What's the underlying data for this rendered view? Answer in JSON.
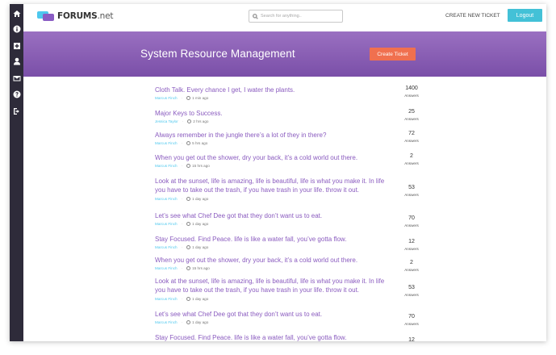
{
  "app": {
    "logo_brand": "FORUMS",
    "logo_suffix": ".net"
  },
  "sidebar": {
    "items": [
      {
        "icon": "home-icon"
      },
      {
        "icon": "info-icon"
      },
      {
        "icon": "plus-square-icon"
      },
      {
        "icon": "user-icon"
      },
      {
        "icon": "envelope-icon"
      },
      {
        "icon": "question-icon"
      },
      {
        "icon": "sign-out-icon"
      }
    ]
  },
  "header": {
    "search_placeholder": "Search for anything..",
    "create_link": "CREATE NEW TICKET",
    "logout_label": "Logout"
  },
  "hero": {
    "title": "System Resource Management",
    "create_ticket_label": "Create Ticket"
  },
  "questions": [
    {
      "title": "Cloth Talk. Every chance I get, I water the plants.",
      "author": "Marcus Finch",
      "time": "1 min ago",
      "count": "1400",
      "count_label": "Answers"
    },
    {
      "title": "Major Keys to Success.",
      "author": "Jessica Taylor",
      "time": "2 hrs ago",
      "count": "25",
      "count_label": "Answers"
    },
    {
      "title": "Always remember in the jungle there’s a lot of they in there?",
      "author": "Marcus Finch",
      "time": "5 hrs ago",
      "count": "72",
      "count_label": "Answers"
    },
    {
      "title": "When you get out the shower, dry your back, it’s a cold world out there.",
      "author": "Marcus Finch",
      "time": "15 hrs ago",
      "count": "2",
      "count_label": "Answers"
    },
    {
      "title": "Look at the sunset, life is amazing, life is beautiful, life is what you make it. In life you have to take out the trash, if you have trash in your life. throw it out.",
      "author": "Marcus Finch",
      "time": "1 day ago",
      "count": "53",
      "count_label": "Answers"
    },
    {
      "title": "Let’s see what Chef Dee got that they don’t want us to eat.",
      "author": "Marcus Finch",
      "time": "1 day ago",
      "count": "70",
      "count_label": "Answers"
    },
    {
      "title": "Stay Focused. Find Peace. life is like a water fall, you’ve gotta flow.",
      "author": "Marcus Finch",
      "time": "1 day ago",
      "count": "12",
      "count_label": "Answers"
    },
    {
      "title": "When you get out the shower, dry your back, it’s a cold world out there.",
      "author": "Marcus Finch",
      "time": "15 hrs ago",
      "count": "2",
      "count_label": "Answers"
    },
    {
      "title": "Look at the sunset, life is amazing, life is beautiful, life is what you make it. In life you have to take out the trash, if you have trash in your life. throw it out.",
      "author": "Marcus Finch",
      "time": "1 day ago",
      "count": "53",
      "count_label": "Answers"
    },
    {
      "title": "Let’s see what Chef Dee got that they don’t want us to eat.",
      "author": "Marcus Finch",
      "time": "1 day ago",
      "count": "70",
      "count_label": "Answers"
    },
    {
      "title": "Stay Focused. Find Peace. life is like a water fall, you’ve gotta flow.",
      "author": "",
      "time": "",
      "count": "12",
      "count_label": ""
    }
  ],
  "colors": {
    "sidebar": "#2e2b3a",
    "accent_purple": "#8a5bbf",
    "accent_cyan": "#43c1d7",
    "accent_orange": "#f0704f"
  }
}
